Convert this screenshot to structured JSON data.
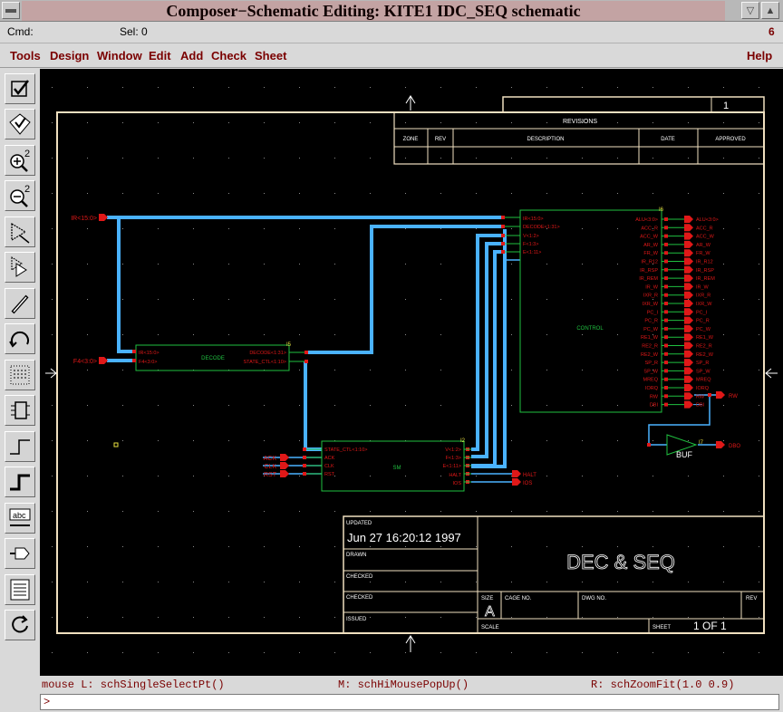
{
  "window": {
    "title": "Composer−Schematic Editing: KITE1 IDC_SEQ schematic",
    "buttons": [
      "▽",
      "▲"
    ]
  },
  "cmdbar": {
    "cmd_label": "Cmd:",
    "sel_label": "Sel: 0",
    "count": "6"
  },
  "menus": [
    "Tools",
    "Design",
    "Window",
    "Edit",
    "Add",
    "Check",
    "Sheet",
    "Help"
  ],
  "tools": [
    {
      "name": "check-icon"
    },
    {
      "name": "check-and-save-icon"
    },
    {
      "name": "zoom-in-icon",
      "label": "2"
    },
    {
      "name": "zoom-out-icon",
      "label": "2"
    },
    {
      "name": "stretch-icon"
    },
    {
      "name": "copy-icon"
    },
    {
      "name": "delete-icon"
    },
    {
      "name": "undo-icon"
    },
    {
      "name": "property-icon"
    },
    {
      "name": "instance-icon"
    },
    {
      "name": "wire-narrow-icon"
    },
    {
      "name": "wire-wide-icon"
    },
    {
      "name": "wire-name-icon",
      "label": "abc"
    },
    {
      "name": "pin-icon"
    },
    {
      "name": "cmd-options-icon"
    },
    {
      "name": "repeat-icon"
    }
  ],
  "schematic": {
    "revisions": {
      "title": "REVISIONS",
      "headers": [
        "ZONE",
        "REV",
        "DESCRIPTION",
        "DATE",
        "APPROVED"
      ]
    },
    "page_number": "1",
    "title_block": {
      "updated_label": "UPDATED",
      "updated_value": "Jun 27 16:20:12 1997",
      "drawn_label": "DRAWN",
      "checked_label": "CHECKED",
      "checked2_label": "CHECKED",
      "issued_label": "ISSUED",
      "design_title": "DEC & SEQ",
      "size_label": "SIZE",
      "size_value": "A",
      "cage_label": "CAGE NO.",
      "dwg_label": "DWG NO.",
      "rev_label": "REV",
      "scale_label": "SCALE",
      "sheet_label": "SHEET",
      "sheet_value": "1 OF 1"
    },
    "input_pins": [
      {
        "label": "IR<15:0>"
      },
      {
        "label": "F4<3:0>"
      },
      {
        "label": "ACK"
      },
      {
        "label": "CLK"
      },
      {
        "label": "RST"
      }
    ],
    "decode": {
      "name": "DECODE",
      "inst": "I5",
      "inputs": [
        "IR<15:0>",
        "F4<3:0>"
      ],
      "outputs": [
        "DECODE<1:31>",
        "STATE_CTL<1:10>"
      ]
    },
    "sm": {
      "name": "SM",
      "inst": "I2",
      "inputs": [
        "STATE_CTL<1:10>",
        "ACK",
        "CLK",
        "RST"
      ],
      "outputs": [
        "V<1:2>",
        "F<1:3>",
        "E<1:11>",
        "HALT",
        "IOS"
      ]
    },
    "sm_output_pins": [
      "HALT",
      "IOS"
    ],
    "control": {
      "name": "CONTROL",
      "inst": "I6",
      "inputs": [
        "IR<15:0>",
        "DECODE<1:31>",
        "V<1:2>",
        "F<1:3>",
        "E<1:11>"
      ],
      "outputs": [
        "ALU<3:0>",
        "ACC_R",
        "ACC_W",
        "AR_W",
        "FR_W",
        "IR_R12",
        "IR_RSP",
        "IR_REM",
        "IR_W",
        "IXR_R",
        "IXR_W",
        "PC_I",
        "PC_R",
        "PC_W",
        "RE1_W",
        "RE2_R",
        "RE2_W",
        "SP_R",
        "SP_W",
        "MREQ",
        "IORQ",
        "RW",
        "DBI"
      ],
      "pins": [
        "ALU<3:0>",
        "ACC_R",
        "ACC_W",
        "AR_W",
        "FR_W",
        "IR_R12",
        "IR_RSP",
        "IR_REM",
        "IR_W",
        "IXR_R",
        "IXR_W",
        "PC_I",
        "PC_R",
        "PC_W",
        "RE1_W",
        "RE2_R",
        "RE2_W",
        "SP_R",
        "SP_W",
        "MREQ",
        "IORQ",
        "RW",
        "DBI"
      ]
    },
    "rw_pin": "RW",
    "buffer": {
      "name": "BUF",
      "inst": "I7",
      "out_pin": "DBO"
    }
  },
  "status": {
    "left": "mouse L: schSingleSelectPt()",
    "middle": "M: schHiMousePopUp()",
    "right": "R: schZoomFit(1.0 0.9)"
  },
  "prompt": ">",
  "colors": {
    "title_bg": "#c3a3a3",
    "canvas_bg": "#000000",
    "frame": "#f0e0c0",
    "bus": "#4ab2ff",
    "pin": "#e01818",
    "symbol": "#20c040",
    "wire": "#4ab2ff",
    "menu_text": "#7a0000"
  }
}
